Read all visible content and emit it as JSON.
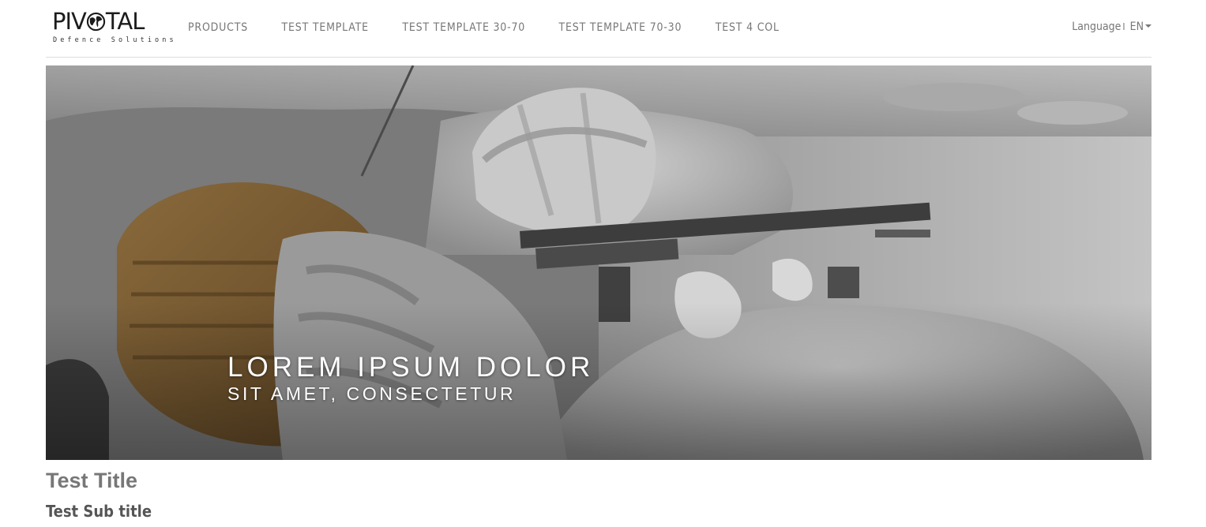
{
  "brand": {
    "name_left": "PIV",
    "name_right": "TAL",
    "tagline": "Defence Solutions"
  },
  "nav": {
    "items": [
      {
        "label": "PRODUCTS"
      },
      {
        "label": "TEST TEMPLATE"
      },
      {
        "label": "TEST TEMPLATE 30-70"
      },
      {
        "label": "TEST TEMPLATE 70-30"
      },
      {
        "label": "TEST 4 COL"
      }
    ],
    "language_label": "Language",
    "language_separator": "I",
    "language_value": "EN",
    "icons": {
      "logo_globe": "globe-icon",
      "language_caret": "caret-down-icon"
    }
  },
  "hero": {
    "heading": "LOREM IPSUM DOLOR",
    "subheading": "SIT AMET, CONSECTETUR",
    "image_subject": "soldier-aiming-rifle-photo"
  },
  "content": {
    "title": "Test Title",
    "subtitle": "Test Sub title"
  },
  "colors": {
    "nav_text": "#777777",
    "title_text": "#777777",
    "hero_text": "#ffffff",
    "divider": "#dddddd"
  }
}
